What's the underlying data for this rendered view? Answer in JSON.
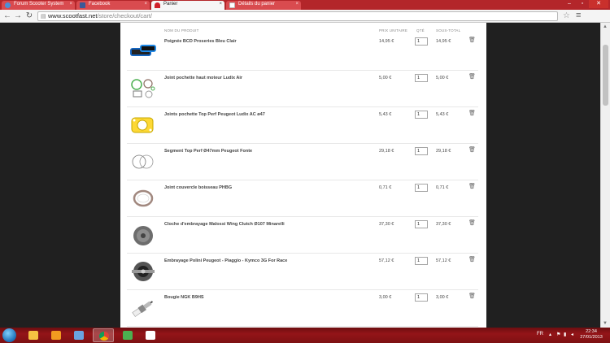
{
  "browser": {
    "tabs": [
      {
        "label": "Forum Scooter System"
      },
      {
        "label": "Facebook"
      },
      {
        "label": "Panier"
      },
      {
        "label": "Détails du panier"
      }
    ],
    "url_host": "www.scootfast.net",
    "url_path": "/store/checkout/cart/"
  },
  "cart": {
    "headers": {
      "product": "NOM DU PRODUIT",
      "unit_price": "PRIX UNITAIRE",
      "qty": "QTÉ",
      "subtotal": "SOUS-TOTAL"
    },
    "rows": [
      {
        "name": "Poignée BCD Proseries Bleu Clair",
        "unit": "14,95 €",
        "qty": "1",
        "subtotal": "14,95 €"
      },
      {
        "name": "Joint pochette haut moteur Ludix Air",
        "unit": "5,00 €",
        "qty": "1",
        "subtotal": "5,00 €"
      },
      {
        "name": "Joints pochette Top Perf Peugeot Ludix AC ø47",
        "unit": "5,43 €",
        "qty": "1",
        "subtotal": "5,43 €"
      },
      {
        "name": "Segment Top Perf Ø47mm Peugeot Fonte",
        "unit": "29,18 €",
        "qty": "1",
        "subtotal": "29,18 €"
      },
      {
        "name": "Joint couvercle boisseau PHBG",
        "unit": "0,71 €",
        "qty": "1",
        "subtotal": "0,71 €"
      },
      {
        "name": "Cloche d'embrayage Malossi Wing Clutch Ø107 Minarelli",
        "unit": "37,30 €",
        "qty": "1",
        "subtotal": "37,30 €"
      },
      {
        "name": "Embrayage Polini Peugeot - Piaggio - Kymco 3G For Race",
        "unit": "57,12 €",
        "qty": "1",
        "subtotal": "57,12 €"
      },
      {
        "name": "Bougie NGK B9HS",
        "unit": "3,00 €",
        "qty": "1",
        "subtotal": "3,00 €"
      }
    ]
  },
  "taskbar": {
    "lang": "FR",
    "time": "22:34",
    "date": "27/01/2013"
  },
  "colors": {
    "titlebar": "#b3262a",
    "taskbar": "#941418",
    "page_bg": "#202020"
  }
}
